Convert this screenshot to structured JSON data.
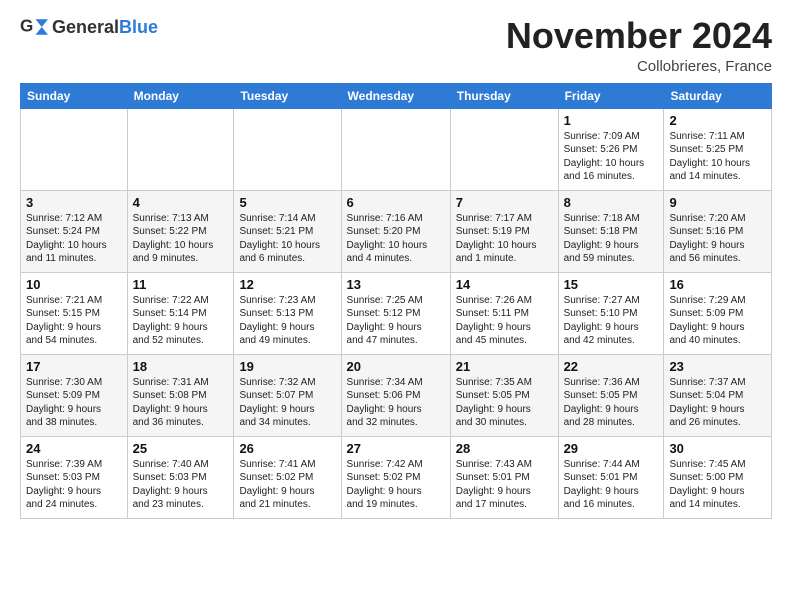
{
  "header": {
    "logo_general": "General",
    "logo_blue": "Blue",
    "month": "November 2024",
    "location": "Collobrieres, France"
  },
  "weekdays": [
    "Sunday",
    "Monday",
    "Tuesday",
    "Wednesday",
    "Thursday",
    "Friday",
    "Saturday"
  ],
  "weeks": [
    [
      {
        "day": "",
        "info": ""
      },
      {
        "day": "",
        "info": ""
      },
      {
        "day": "",
        "info": ""
      },
      {
        "day": "",
        "info": ""
      },
      {
        "day": "",
        "info": ""
      },
      {
        "day": "1",
        "info": "Sunrise: 7:09 AM\nSunset: 5:26 PM\nDaylight: 10 hours\nand 16 minutes."
      },
      {
        "day": "2",
        "info": "Sunrise: 7:11 AM\nSunset: 5:25 PM\nDaylight: 10 hours\nand 14 minutes."
      }
    ],
    [
      {
        "day": "3",
        "info": "Sunrise: 7:12 AM\nSunset: 5:24 PM\nDaylight: 10 hours\nand 11 minutes."
      },
      {
        "day": "4",
        "info": "Sunrise: 7:13 AM\nSunset: 5:22 PM\nDaylight: 10 hours\nand 9 minutes."
      },
      {
        "day": "5",
        "info": "Sunrise: 7:14 AM\nSunset: 5:21 PM\nDaylight: 10 hours\nand 6 minutes."
      },
      {
        "day": "6",
        "info": "Sunrise: 7:16 AM\nSunset: 5:20 PM\nDaylight: 10 hours\nand 4 minutes."
      },
      {
        "day": "7",
        "info": "Sunrise: 7:17 AM\nSunset: 5:19 PM\nDaylight: 10 hours\nand 1 minute."
      },
      {
        "day": "8",
        "info": "Sunrise: 7:18 AM\nSunset: 5:18 PM\nDaylight: 9 hours\nand 59 minutes."
      },
      {
        "day": "9",
        "info": "Sunrise: 7:20 AM\nSunset: 5:16 PM\nDaylight: 9 hours\nand 56 minutes."
      }
    ],
    [
      {
        "day": "10",
        "info": "Sunrise: 7:21 AM\nSunset: 5:15 PM\nDaylight: 9 hours\nand 54 minutes."
      },
      {
        "day": "11",
        "info": "Sunrise: 7:22 AM\nSunset: 5:14 PM\nDaylight: 9 hours\nand 52 minutes."
      },
      {
        "day": "12",
        "info": "Sunrise: 7:23 AM\nSunset: 5:13 PM\nDaylight: 9 hours\nand 49 minutes."
      },
      {
        "day": "13",
        "info": "Sunrise: 7:25 AM\nSunset: 5:12 PM\nDaylight: 9 hours\nand 47 minutes."
      },
      {
        "day": "14",
        "info": "Sunrise: 7:26 AM\nSunset: 5:11 PM\nDaylight: 9 hours\nand 45 minutes."
      },
      {
        "day": "15",
        "info": "Sunrise: 7:27 AM\nSunset: 5:10 PM\nDaylight: 9 hours\nand 42 minutes."
      },
      {
        "day": "16",
        "info": "Sunrise: 7:29 AM\nSunset: 5:09 PM\nDaylight: 9 hours\nand 40 minutes."
      }
    ],
    [
      {
        "day": "17",
        "info": "Sunrise: 7:30 AM\nSunset: 5:09 PM\nDaylight: 9 hours\nand 38 minutes."
      },
      {
        "day": "18",
        "info": "Sunrise: 7:31 AM\nSunset: 5:08 PM\nDaylight: 9 hours\nand 36 minutes."
      },
      {
        "day": "19",
        "info": "Sunrise: 7:32 AM\nSunset: 5:07 PM\nDaylight: 9 hours\nand 34 minutes."
      },
      {
        "day": "20",
        "info": "Sunrise: 7:34 AM\nSunset: 5:06 PM\nDaylight: 9 hours\nand 32 minutes."
      },
      {
        "day": "21",
        "info": "Sunrise: 7:35 AM\nSunset: 5:05 PM\nDaylight: 9 hours\nand 30 minutes."
      },
      {
        "day": "22",
        "info": "Sunrise: 7:36 AM\nSunset: 5:05 PM\nDaylight: 9 hours\nand 28 minutes."
      },
      {
        "day": "23",
        "info": "Sunrise: 7:37 AM\nSunset: 5:04 PM\nDaylight: 9 hours\nand 26 minutes."
      }
    ],
    [
      {
        "day": "24",
        "info": "Sunrise: 7:39 AM\nSunset: 5:03 PM\nDaylight: 9 hours\nand 24 minutes."
      },
      {
        "day": "25",
        "info": "Sunrise: 7:40 AM\nSunset: 5:03 PM\nDaylight: 9 hours\nand 23 minutes."
      },
      {
        "day": "26",
        "info": "Sunrise: 7:41 AM\nSunset: 5:02 PM\nDaylight: 9 hours\nand 21 minutes."
      },
      {
        "day": "27",
        "info": "Sunrise: 7:42 AM\nSunset: 5:02 PM\nDaylight: 9 hours\nand 19 minutes."
      },
      {
        "day": "28",
        "info": "Sunrise: 7:43 AM\nSunset: 5:01 PM\nDaylight: 9 hours\nand 17 minutes."
      },
      {
        "day": "29",
        "info": "Sunrise: 7:44 AM\nSunset: 5:01 PM\nDaylight: 9 hours\nand 16 minutes."
      },
      {
        "day": "30",
        "info": "Sunrise: 7:45 AM\nSunset: 5:00 PM\nDaylight: 9 hours\nand 14 minutes."
      }
    ]
  ]
}
